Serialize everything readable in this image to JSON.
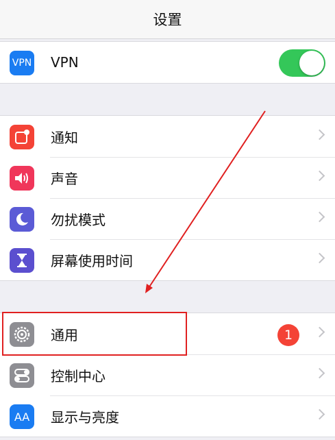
{
  "nav": {
    "title": "设置"
  },
  "vpn": {
    "icon_text": "VPN",
    "label": "VPN",
    "toggle_on": true
  },
  "group2": {
    "items": [
      {
        "label": "通知",
        "icon": "notifications-icon",
        "color": "#f44336"
      },
      {
        "label": "声音",
        "icon": "sounds-icon",
        "color": "#f0365a"
      },
      {
        "label": "勿扰模式",
        "icon": "do-not-disturb-moon-icon",
        "color": "#5b5bd6"
      },
      {
        "label": "屏幕使用时间",
        "icon": "hourglass-icon",
        "color": "#5b4fcf"
      }
    ]
  },
  "group3": {
    "items": [
      {
        "label": "通用",
        "icon": "gear-icon",
        "color": "#8e8e93",
        "badge": "1"
      },
      {
        "label": "控制中心",
        "icon": "toggles-icon",
        "color": "#8e8e93"
      },
      {
        "label": "显示与亮度",
        "icon_text": "AA",
        "icon": "display-icon",
        "color": "#1a7cf2"
      }
    ]
  },
  "colors": {
    "toggle_green": "#34c759",
    "annotation_red": "#e02020",
    "badge_red": "#f44336"
  }
}
